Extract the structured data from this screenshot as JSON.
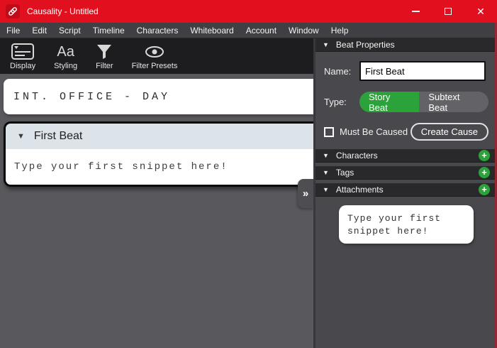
{
  "icons": {
    "triangle_down": "▼",
    "chevron_collapse": "»",
    "plus": "+",
    "close": "✕",
    "styling_glyph": "Aa"
  },
  "window": {
    "title": "Causality - Untitled"
  },
  "menu": {
    "items": [
      "File",
      "Edit",
      "Script",
      "Timeline",
      "Characters",
      "Whiteboard",
      "Account",
      "Window",
      "Help"
    ]
  },
  "toolbar": {
    "items": [
      {
        "label": "Display"
      },
      {
        "label": "Styling"
      },
      {
        "label": "Filter"
      },
      {
        "label": "Filter Presets"
      }
    ]
  },
  "script_panel": {
    "scene_heading": "INT. OFFICE - DAY",
    "beat": {
      "title": "First Beat",
      "snippet": "Type your first snippet here!"
    }
  },
  "sidebar": {
    "beat_properties": {
      "header": "Beat Properties",
      "name_label": "Name:",
      "name_value": "First Beat",
      "type_label": "Type:",
      "type_options": [
        {
          "label": "Story Beat",
          "selected": true
        },
        {
          "label": "Subtext Beat",
          "selected": false
        }
      ],
      "must_be_caused": {
        "label": "Must Be Caused",
        "checked": false
      },
      "create_cause_label": "Create Cause"
    },
    "sections": [
      {
        "label": "Characters"
      },
      {
        "label": "Tags"
      },
      {
        "label": "Attachments"
      }
    ],
    "attachment_preview_text": "Type your first snippet here!"
  },
  "colors": {
    "titlebar_red": "#e1101e",
    "accent_green": "#2ba33a",
    "beat_header_blue": "#dce3e9",
    "window_edge_red": "#97262e",
    "toolbar_dark": "#1d1d1f",
    "sidebar_gray": "#49494d",
    "content_gray": "#59595d"
  }
}
